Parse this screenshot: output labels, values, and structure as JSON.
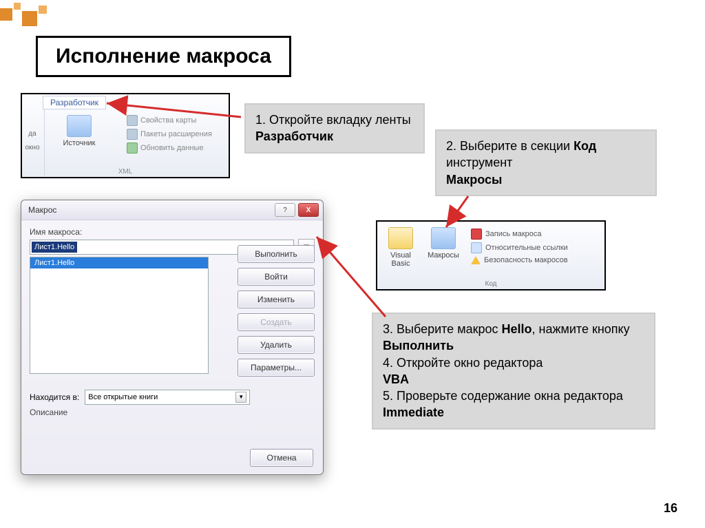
{
  "slide": {
    "title": "Исполнение макроса",
    "page_number": "16"
  },
  "callouts": {
    "step1_prefix": "1. Откройте вкладку ленты ",
    "step1_bold": "Разработчик",
    "step2_a": "2. Выберите в секции ",
    "step2_b": "Код",
    "step2_c": " инструмент ",
    "step2_d": "Макросы",
    "step3_a": "3. Выберите макрос ",
    "step3_b": "Hello",
    "step3_c": ", нажмите кнопку ",
    "step3_d": "Выполнить",
    "step4_a": "4. Откройте окно редактора ",
    "step4_b": "VBA",
    "step5_a": "5. Проверьте  содержание окна редактора ",
    "step5_b": "Immediate"
  },
  "ribbon1": {
    "tab": "Разработчик",
    "edge1": "да",
    "edge2": "окно",
    "source": "Источник",
    "prop": "Свойства карты",
    "packs": "Пакеты расширения",
    "refresh": "Обновить данные",
    "group": "XML"
  },
  "ribbon2": {
    "vb": "Visual Basic",
    "macros": "Макросы",
    "rec": "Запись макроса",
    "rel": "Относительные ссылки",
    "sec": "Безопасность макросов",
    "group": "Код"
  },
  "dialog": {
    "title": "Макрос",
    "help": "?",
    "close": "X",
    "name_label": "Имя макроса:",
    "name_value": "Лист1.Hello",
    "list_item": "Лист1.Hello",
    "run": "Выполнить",
    "stepinto": "Войти",
    "edit": "Изменить",
    "create": "Создать",
    "delete": "Удалить",
    "options": "Параметры...",
    "loc_label": "Находится в:",
    "loc_value": "Все открытые книги",
    "desc_label": "Описание",
    "cancel": "Отмена"
  }
}
